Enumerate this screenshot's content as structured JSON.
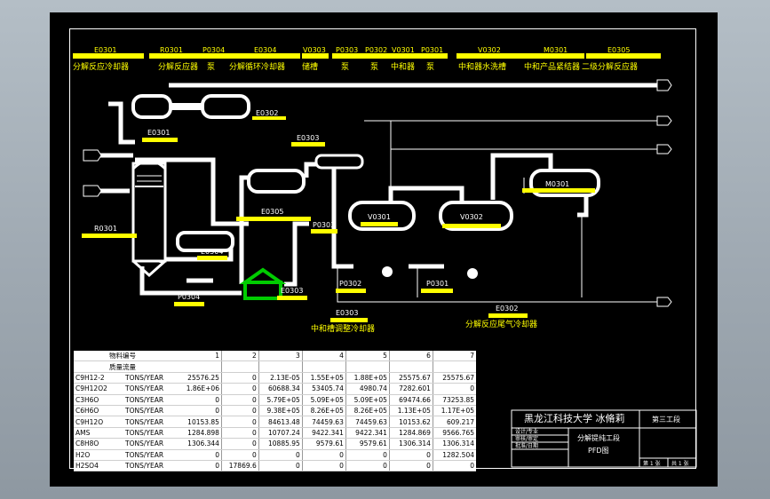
{
  "drawing": {
    "top_codes": [
      "E0301",
      "R0301",
      "P0304",
      "E0304",
      "V0303",
      "P0303",
      "P0302",
      "V0301",
      "P0301",
      "V0302",
      "M0301",
      "E0305"
    ],
    "top_names": [
      "分解反应冷却器",
      "分解反应器",
      "泵",
      "分解循环冷却器",
      "储槽",
      "泵",
      "泵",
      "中和器",
      "泵",
      "中和器水洗槽",
      "中和产品紧结器",
      "二级分解反应器"
    ],
    "equipment_tags": {
      "e0302": "E0302",
      "e0301": "E0301",
      "e0303_up": "E0303",
      "e0305": "E0305",
      "r0301": "R0301",
      "e0304": "E0304",
      "p0304": "P0304",
      "e0303_low": "E0303",
      "p0303": "P0303",
      "v0301": "V0301",
      "v0302": "V0302",
      "m0301": "M0301",
      "p0302": "P0302",
      "p0301": "P0301"
    },
    "bottom_labels": {
      "e0303_code": "E0303",
      "e0303_name": "中和槽调整冷却器",
      "e0302_code": "E0302",
      "e0302_name": "分解反应尾气冷却器"
    },
    "colors": {
      "line": "#ffffff",
      "tag_bar": "#ffff00",
      "frame": "#000000",
      "accent": "#00cc00"
    }
  },
  "table": {
    "header1": {
      "label": "物料编号",
      "cols": [
        "1",
        "2",
        "3",
        "4",
        "5",
        "6",
        "7"
      ]
    },
    "header2": {
      "label": "质量流量"
    },
    "rows": [
      {
        "name": "C9H12-2",
        "unit": "TONS/YEAR",
        "vals": [
          "25576.25",
          "0",
          "2.13E-05",
          "1.55E+05",
          "1.88E+05",
          "25575.67",
          "25575.67"
        ]
      },
      {
        "name": "C9H12O2",
        "unit": "TONS/YEAR",
        "vals": [
          "1.86E+06",
          "0",
          "60688.34",
          "53405.74",
          "4980.74",
          "7282.601",
          "0"
        ]
      },
      {
        "name": "C3H6O",
        "unit": "TONS/YEAR",
        "vals": [
          "0",
          "0",
          "5.79E+05",
          "5.09E+05",
          "5.09E+05",
          "69474.66",
          "73253.85"
        ]
      },
      {
        "name": "C6H6O",
        "unit": "TONS/YEAR",
        "vals": [
          "0",
          "0",
          "9.38E+05",
          "8.26E+05",
          "8.26E+05",
          "1.13E+05",
          "1.17E+05"
        ]
      },
      {
        "name": "C9H12O",
        "unit": "TONS/YEAR",
        "vals": [
          "10153.85",
          "0",
          "84613.48",
          "74459.63",
          "74459.63",
          "10153.62",
          "609.217"
        ]
      },
      {
        "name": "AMS",
        "unit": "TONS/YEAR",
        "vals": [
          "1284.898",
          "0",
          "10707.24",
          "9422.341",
          "9422.341",
          "1284.869",
          "9566.765"
        ]
      },
      {
        "name": "C8H8O",
        "unit": "TONS/YEAR",
        "vals": [
          "1306.344",
          "0",
          "10885.95",
          "9579.61",
          "9579.61",
          "1306.314",
          "1306.314"
        ]
      },
      {
        "name": "H2O",
        "unit": "TONS/YEAR",
        "vals": [
          "0",
          "0",
          "0",
          "0",
          "0",
          "0",
          "1282.504"
        ]
      },
      {
        "name": "H2SO4",
        "unit": "TONS/YEAR",
        "vals": [
          "0",
          "17869.6",
          "0",
          "0",
          "0",
          "0",
          "0"
        ]
      }
    ]
  },
  "title_block": {
    "school": "黑龙江科技大学 冰脩莉",
    "section": "第三工段",
    "drawing_name": "分解提纯工段",
    "drawing_type": "PFD图",
    "row_a": "设计/专业",
    "row_b": "审核/审定",
    "row_c": "批准/日期",
    "sheet": "第 1 张",
    "total": "共 1 张"
  }
}
